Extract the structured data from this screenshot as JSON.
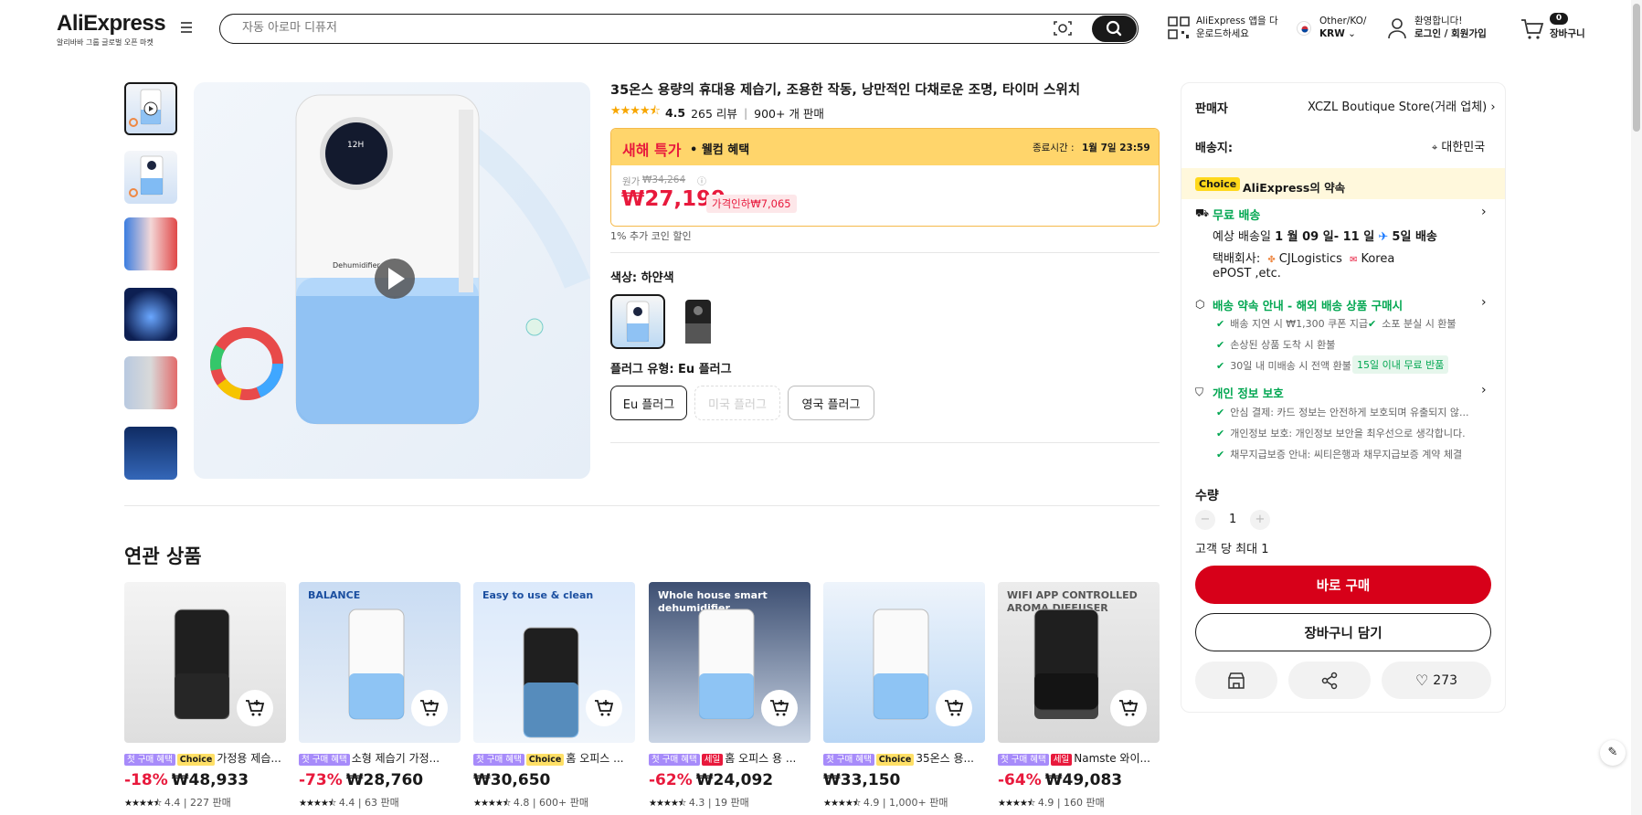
{
  "header": {
    "logo": "AliExpress",
    "logo_sub": "알리바바 그룹 글로벌 오픈 마켓",
    "search_placeholder": "자동 아로마 디퓨저",
    "app_line1": "AliExpress 앱을 다",
    "app_line2": "운로드하세요",
    "locale_line1": "Other/KO/",
    "locale_line2": "KRW",
    "account_line1": "환영합니다!",
    "account_line2": "로그인 / 회원가입",
    "cart_count": "0",
    "cart_label": "장바구니"
  },
  "product": {
    "title": "35온스 용량의 휴대용 제습기, 조용한 작동, 낭만적인 다채로운 조명, 타이머 스위치",
    "rating": "4.5",
    "reviews": "265 리뷰",
    "sold": "900+ 개 판매",
    "promo_title": "새해 특가",
    "promo_sub": "• 웰컴 혜택",
    "end_label": "종료시간 :",
    "end_time": "1월 7일 23:59",
    "orig_label": "원가",
    "orig_price": "₩34,264",
    "price": "₩27,199",
    "price_drop": "가격인하₩7,065",
    "coin_note": "1% 추가 코인 할인",
    "color_label": "색상: 하얀색",
    "plug_label": "플러그 유형: Eu 플러그",
    "plugs": [
      "Eu 플러그",
      "미국 플러그",
      "영국 플러그"
    ],
    "image_text": "12H",
    "image_brand": "Dehumidifier"
  },
  "panel": {
    "seller_label": "판매자",
    "seller_name": "XCZL Boutique Store(거래 업체)",
    "ship_to_label": "배송지:",
    "ship_to": "대한민국",
    "choice": "Choice",
    "choice_promise": "AliExpress의 약속",
    "free_ship": "무료 배송",
    "delivery_prefix": "예상 배송일",
    "delivery_dates": "1 월 09 일- 11 일",
    "delivery_days": "5일 배송",
    "carrier_label": "택배회사:",
    "carrier_1": "CJLogistics",
    "carrier_2": "Korea",
    "carrier_3": "ePOST ,etc.",
    "promise_title": "배송 약속 안내 - 해외 배송 상품 구매시",
    "promise_1": "배송 지연 시 ₩1,300 쿠폰 지급",
    "promise_2": "소포 분실 시 환불",
    "promise_3": "손상된 상품 도착 시 환불",
    "promise_4": "30일 내 미배송 시 전액 환불",
    "promise_badge": "15일 이내 무료 반품",
    "privacy_title": "개인 정보 보호",
    "privacy_1": "안심 결제: 카드 정보는 안전하게 보호되며 유출되지 않...",
    "privacy_2": "개인정보 보호: 개인정보 보안을 최우선으로 생각합니다.",
    "privacy_3": "채무지급보증 안내: 씨티은행과 채무지급보증 계약 체결",
    "qty_label": "수량",
    "qty": "1",
    "qty_limit": "고객 당 최대 1",
    "buy_now": "바로 구매",
    "add_cart": "장바구니 담기",
    "wish_count": "273"
  },
  "related": {
    "title": "연관 상품",
    "items": [
      {
        "badges": [
          "첫 구매 혜택",
          "Choice"
        ],
        "name": "가정용 제습...",
        "discount": "-18%",
        "price": "₩48,933",
        "rating": "4.4",
        "sold": "227 판매",
        "img_text": ""
      },
      {
        "badges": [
          "첫 구매 혜택"
        ],
        "name": "소형 제습기 가정...",
        "discount": "-73%",
        "price": "₩28,760",
        "rating": "4.4",
        "sold": "63 판매",
        "img_text": "BALANCE"
      },
      {
        "badges": [
          "첫 구매 혜택",
          "Choice"
        ],
        "name": "홈 오피스 ...",
        "discount": "",
        "price": "₩30,650",
        "rating": "4.8",
        "sold": "600+ 판매",
        "img_text": "Easy to use & clean"
      },
      {
        "badges": [
          "첫 구매 혜택",
          "세일"
        ],
        "name": "홈 오피스 용 ...",
        "discount": "-62%",
        "price": "₩24,092",
        "rating": "4.3",
        "sold": "19 판매",
        "img_text": "Whole house smart dehumidifier"
      },
      {
        "badges": [
          "첫 구매 혜택",
          "Choice"
        ],
        "name": "35온스 용...",
        "discount": "",
        "price": "₩33,150",
        "rating": "4.9",
        "sold": "1,000+ 판매",
        "img_text": ""
      },
      {
        "badges": [
          "첫 구매 혜택",
          "세일"
        ],
        "name": "Namste 와이...",
        "discount": "-64%",
        "price": "₩49,083",
        "rating": "4.9",
        "sold": "160 판매",
        "img_text": "WIFI APP CONTROLLED AROMA DIFFUSER"
      }
    ]
  },
  "colors": {
    "accent_red": "#e8193c",
    "buy_red": "#d70019",
    "promo_yellow": "#ffd56b",
    "green": "#00a650"
  }
}
